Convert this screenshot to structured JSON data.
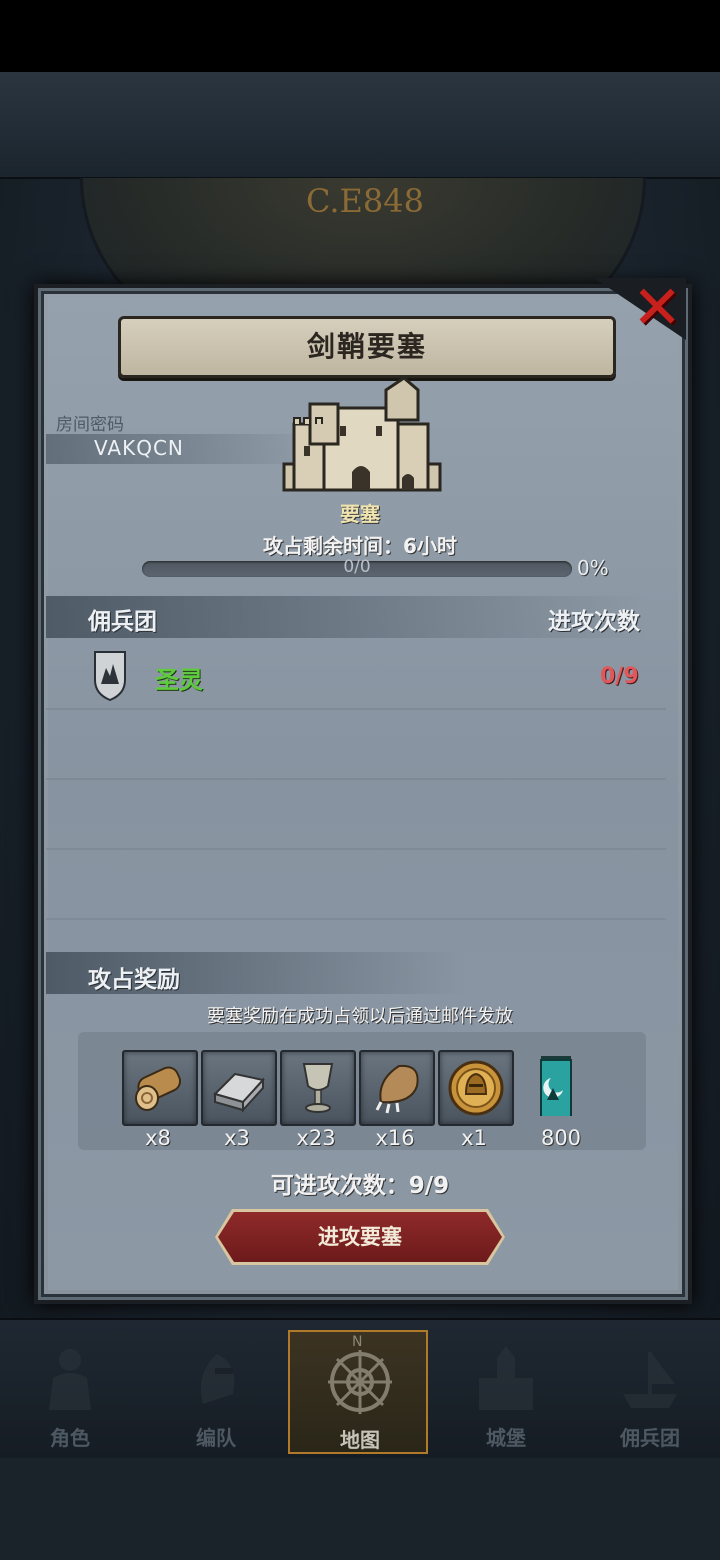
{
  "header": {
    "era_label": "C.E848"
  },
  "modal": {
    "title": "剑鞘要塞",
    "room_label": "房间密码",
    "room_code": "VAKQCN",
    "fort_type": "要塞",
    "time_label": "攻占剩余时间：6小时",
    "progress_text": "0/0",
    "progress_percent_text": "0%",
    "progress_fraction": 0,
    "mercenary_header": "佣兵团",
    "attack_count_header": "进攻次数",
    "mercenaries": [
      {
        "name": "圣灵",
        "attacks": "0/9"
      }
    ],
    "reward_header": "攻占奖励",
    "reward_note": "要塞奖励在成功占领以后通过邮件发放",
    "rewards": [
      {
        "icon": "wood-log-icon",
        "qty": "x8"
      },
      {
        "icon": "iron-ingot-icon",
        "qty": "x3"
      },
      {
        "icon": "goblet-icon",
        "qty": "x23"
      },
      {
        "icon": "claw-icon",
        "qty": "x16"
      },
      {
        "icon": "gold-helmet-coin-icon",
        "qty": "x1"
      },
      {
        "icon": "guild-banner-icon",
        "qty": "800"
      }
    ],
    "remaining_attacks": "可进攻次数：9/9",
    "attack_button": "进攻要塞"
  },
  "nav": {
    "items": [
      {
        "label": "角色",
        "icon": "character-icon"
      },
      {
        "label": "编队",
        "icon": "formation-icon"
      },
      {
        "label": "地图",
        "icon": "map-compass-icon"
      },
      {
        "label": "城堡",
        "icon": "castle-icon"
      },
      {
        "label": "佣兵团",
        "icon": "mercenary-ship-icon"
      }
    ],
    "active_index": 2,
    "north_marker": "N"
  },
  "colors": {
    "guild_name": "#5ecb3c",
    "attack_count": "#e0585a",
    "close_x": "#c8201c",
    "attack_button": "#8f2a2a",
    "active_nav_border": "#b07a2a"
  }
}
